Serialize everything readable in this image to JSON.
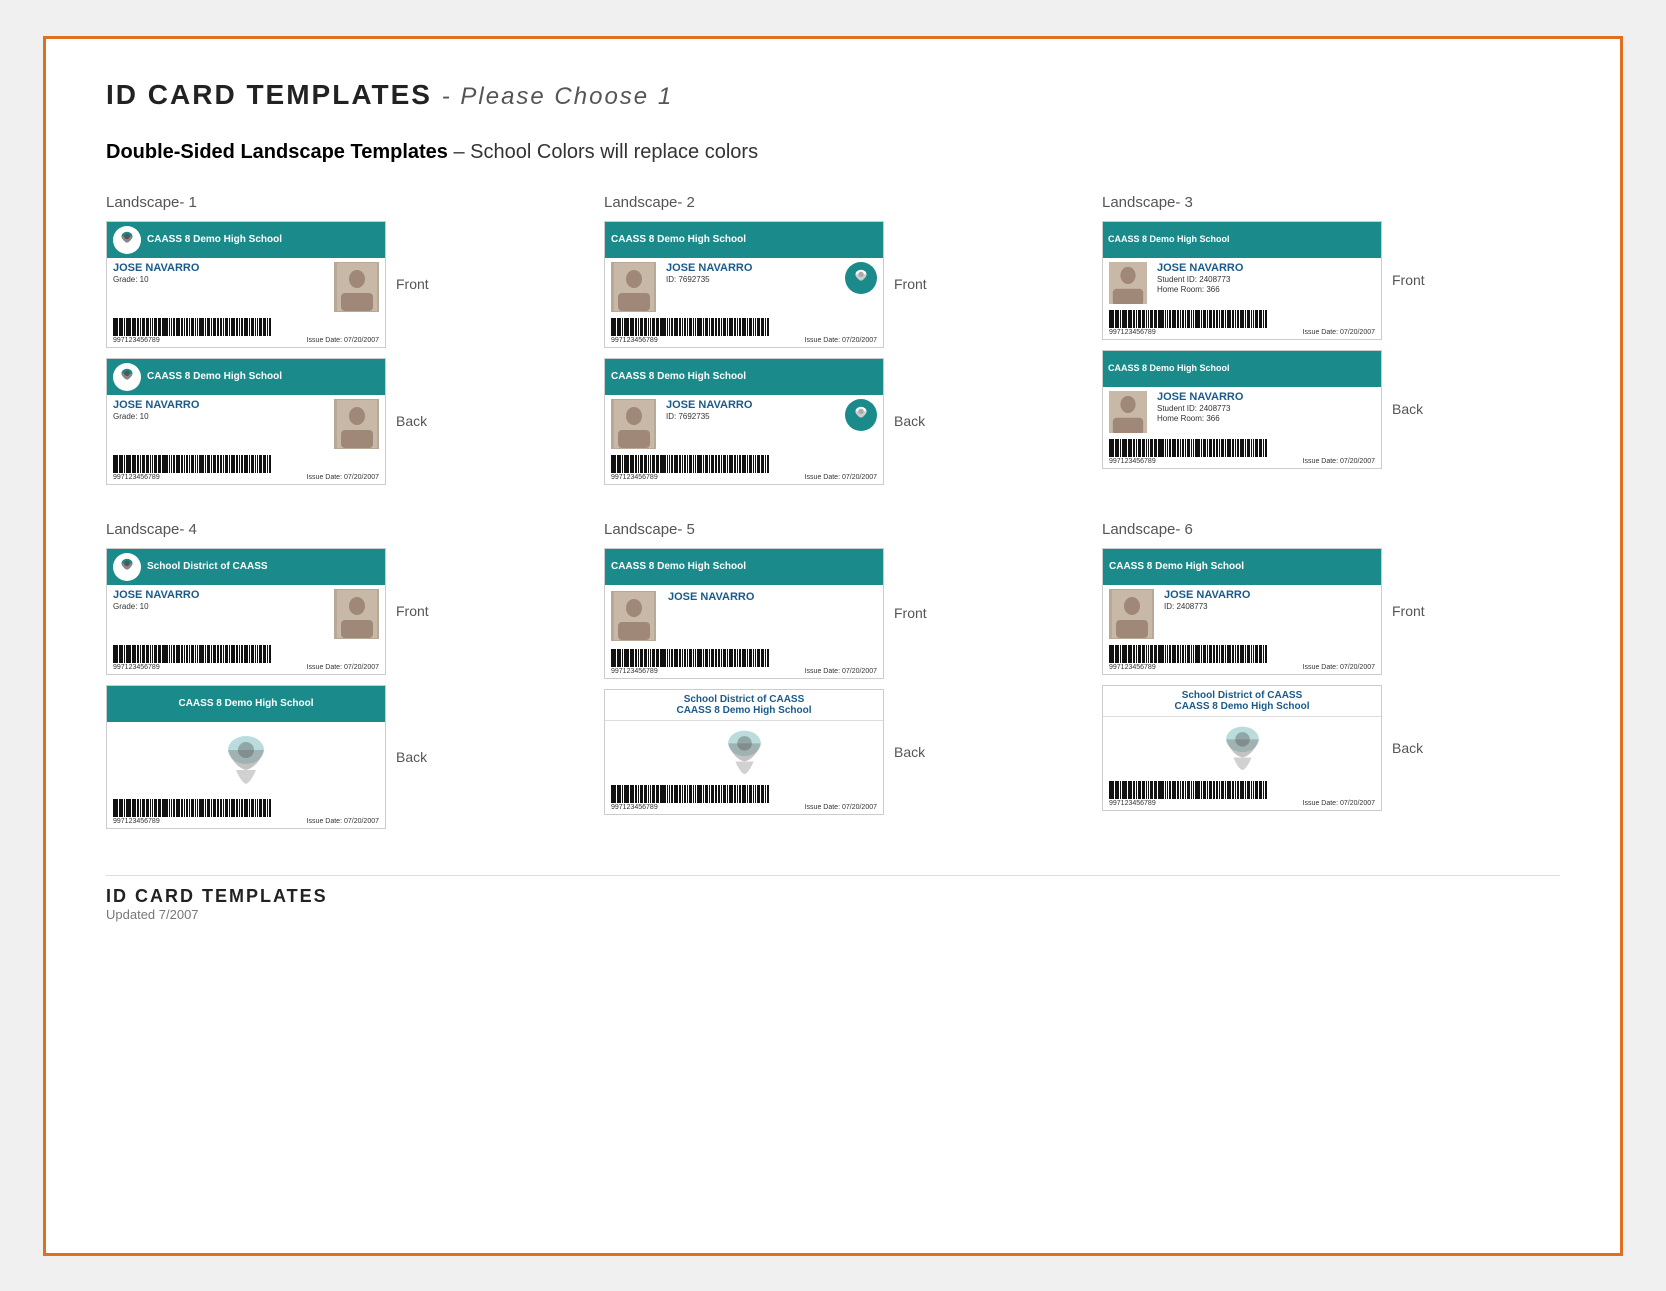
{
  "page": {
    "title": "ID CARD TEMPLATES",
    "subtitle": "Please Choose 1",
    "section_title_bold": "Double-Sided Landscape Templates",
    "section_title_note": "– School Colors will replace colors",
    "border_color": "#e07020",
    "footer_title": "ID CARD TEMPLATES",
    "footer_sub": "Updated 7/2007"
  },
  "templates": [
    {
      "id": "landscape-1",
      "label": "Landscape- 1",
      "front": {
        "school": "CAASS 8 Demo High School",
        "name": "JOSE NAVARRO",
        "detail": "Grade: 10",
        "barcode_num": "997123456789",
        "issue": "Issue Date: 07/20/2007",
        "layout": "logo-left"
      },
      "back": {
        "school": "CAASS 8 Demo High School",
        "name": "JOSE NAVARRO",
        "detail": "Grade: 10",
        "barcode_num": "997123456789",
        "issue": "Issue Date: 07/20/2007",
        "layout": "logo-left"
      }
    },
    {
      "id": "landscape-2",
      "label": "Landscape- 2",
      "front": {
        "school": "CAASS 8 Demo High School",
        "name": "JOSE NAVARRO",
        "detail": "ID: 7692735",
        "barcode_num": "997123456789",
        "issue": "Issue Date: 07/20/2007",
        "layout": "logo-right"
      },
      "back": {
        "school": "CAASS 8 Demo High School",
        "name": "JOSE NAVARRO",
        "detail": "ID: 7692735",
        "barcode_num": "997123456789",
        "issue": "Issue Date: 07/20/2007",
        "layout": "logo-right"
      }
    },
    {
      "id": "landscape-3",
      "label": "Landscape- 3",
      "front": {
        "school": "CAASS 8 Demo High School",
        "name": "JOSE NAVARRO",
        "detail1": "Student ID: 2408773",
        "detail2": "Home Room: 366",
        "barcode_num": "997123456789",
        "issue": "Issue Date: 07/20/2007",
        "layout": "small"
      },
      "back": {
        "school": "CAASS 8 Demo High School",
        "name": "JOSE NAVARRO",
        "detail1": "Student ID: 2408773",
        "detail2": "Home Room: 366",
        "barcode_num": "997123456789",
        "issue": "Issue Date: 07/20/2007",
        "layout": "small"
      }
    },
    {
      "id": "landscape-4",
      "label": "Landscape- 4",
      "front": {
        "school": "School District of CAASS",
        "name": "JOSE NAVARRO",
        "detail": "Grade: 10",
        "barcode_num": "997123456789",
        "issue": "Issue Date: 07/20/2007",
        "layout": "logo-left"
      },
      "back": {
        "school": "CAASS 8 Demo High School",
        "name": "",
        "barcode_num": "997123456789",
        "issue": "Issue Date: 07/20/2007",
        "layout": "back-logo-center"
      }
    },
    {
      "id": "landscape-5",
      "label": "Landscape- 5",
      "front": {
        "school": "CAASS 8 Demo High School",
        "name": "JOSE NAVARRO",
        "barcode_num": "997123456789",
        "issue": "Issue Date: 07/20/2007",
        "layout": "name-only"
      },
      "back": {
        "line1": "School District of CAASS",
        "line2": "CAASS 8 Demo High School",
        "barcode_num": "997123456789",
        "issue": "Issue Date: 07/20/2007",
        "layout": "dual-header"
      }
    },
    {
      "id": "landscape-6",
      "label": "Landscape- 6",
      "front": {
        "school": "CAASS 8 Demo High School",
        "name": "JOSE NAVARRO",
        "detail": "ID: 2408773",
        "barcode_num": "997123456789",
        "issue": "Issue Date: 07/20/2007",
        "layout": "logo-right"
      },
      "back": {
        "line1": "School District of CAASS",
        "line2": "CAASS 8 Demo High School",
        "barcode_num": "997123456789",
        "issue": "Issue Date: 07/20/2007",
        "layout": "dual-header"
      }
    }
  ]
}
